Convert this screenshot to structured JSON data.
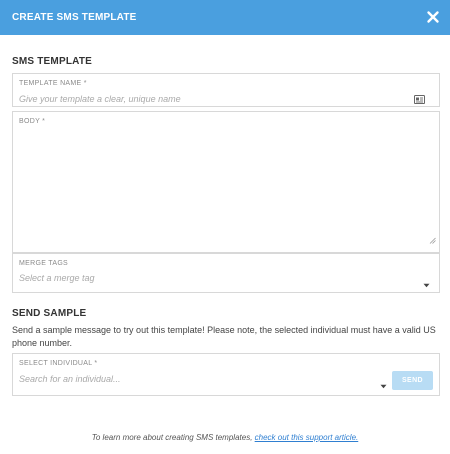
{
  "header": {
    "title": "CREATE SMS TEMPLATE"
  },
  "sms_template": {
    "title": "SMS TEMPLATE",
    "name_label": "TEMPLATE NAME *",
    "name_placeholder": "Give your template a clear, unique name",
    "body_label": "BODY *",
    "body_value": "",
    "merge_label": "MERGE TAGS",
    "merge_placeholder": "Select a merge tag"
  },
  "send_sample": {
    "title": "SEND SAMPLE",
    "description": "Send a sample message to try out this template! Please note, the selected individual must have a valid US phone number.",
    "individual_label": "SELECT INDIVIDUAL *",
    "individual_placeholder": "Search for an individual...",
    "send_label": "SEND"
  },
  "footer": {
    "text": "To learn more about creating SMS templates, ",
    "link": "check out this support article."
  },
  "colors": {
    "header": "#4a9fdf",
    "send_disabled": "#b8dcf4",
    "link": "#2f7fd1"
  },
  "icons": {
    "close": "close-icon",
    "template": "card-icon",
    "dropdown": "caret-down-icon",
    "resize": "resize-grip-icon"
  }
}
